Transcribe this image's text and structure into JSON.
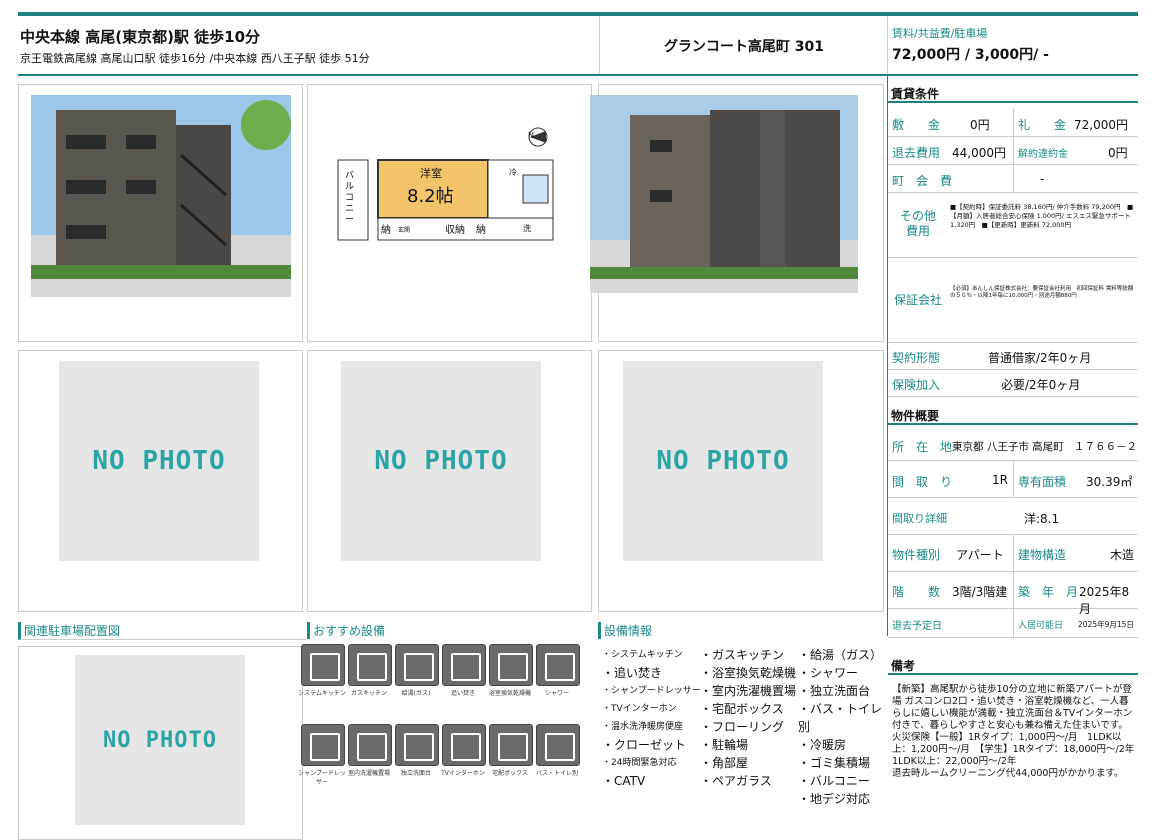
{
  "header": {
    "station_main": "中央本線 高尾(東京都)駅 徒歩10分",
    "station_sub": "京王電鉄高尾線 高尾山口駅 徒歩16分 /中央本線 西八王子駅 徒歩 51分",
    "building_name": "グランコート高尾町 301",
    "rent_label": "賃料/共益費/駐車場",
    "rent_value": "72,000円 / 3,000円/ -"
  },
  "photos": {
    "nophoto_text": "NO PHOTO",
    "floorplan": {
      "room": "洋室",
      "size": "8.2帖",
      "balcony": "バルコニー",
      "storage": "収納",
      "nou1": "納",
      "nou2": "納",
      "entrance": "玄関",
      "wash": "洗",
      "fridge": "冷",
      "compass": "N"
    }
  },
  "sections": {
    "parking_map": "関連駐車場配置図",
    "recommended": "おすすめ設備",
    "equipment_info": "設備情報"
  },
  "recommended_icons": [
    {
      "icon": "system-kitchen-icon",
      "label": "システムキッチン"
    },
    {
      "icon": "gas-stove-icon",
      "label": "ガスキッチン"
    },
    {
      "icon": "water-heater-icon",
      "label": "給湯(ガス)"
    },
    {
      "icon": "reheat-bath-icon",
      "label": "追い焚き"
    },
    {
      "icon": "bath-dryer-icon",
      "label": "浴室換気乾燥機"
    },
    {
      "icon": "shower-icon",
      "label": "シャワー"
    },
    {
      "icon": "shampoo-dresser-icon",
      "label": "シャンプードレッサー"
    },
    {
      "icon": "washer-space-icon",
      "label": "室内洗濯機置場"
    },
    {
      "icon": "vanity-icon",
      "label": "独立洗面台"
    },
    {
      "icon": "tv-intercom-icon",
      "label": "TVインターホン"
    },
    {
      "icon": "delivery-box-icon",
      "label": "宅配ボックス"
    },
    {
      "icon": "separate-toilet-icon",
      "label": "バス・トイレ別"
    }
  ],
  "equipment": {
    "col1": [
      "・システムキッチン",
      "・追い焚き",
      "・シャンプードレッサー",
      "・TVインターホン",
      "・温水洗浄暖房便座",
      "・クローゼット",
      "・24時間緊急対応",
      "・CATV"
    ],
    "col2": [
      "・ガスキッチン",
      "・浴室換気乾燥機",
      "・室内洗濯機置場",
      "・宅配ボックス",
      "・フローリング",
      "・駐輪場",
      "・角部屋",
      "・ペアガラス"
    ],
    "col3": [
      "・給湯（ガス）",
      "・シャワー",
      "・独立洗面台",
      "・バス・トイレ別",
      "・冷暖房",
      "・ゴミ集積場",
      "・バルコニー",
      "・地デジ対応"
    ]
  },
  "conditions": {
    "title": "賃貸条件",
    "shikikin_label": "敷　　金",
    "shikikin": "0円",
    "reikin_label": "礼　　金",
    "reikin": "72,000円",
    "taikyo_label": "退去費用",
    "taikyo": "44,000円",
    "kaiyaku_label": "解約違約金",
    "kaiyaku": "0円",
    "choukai_label": "町　会　費",
    "choukai": "-",
    "other_label_1": "その他",
    "other_label_2": "費用",
    "other_text": "■【契約時】保証委託料 38,160円/ 仲介手数料 79,200円　■【月額】入居者総合安心保険 1,000円/ エスエス緊急サポート 1,320円　■【更新時】更新料 72,000円",
    "guarantor_label": "保証会社",
    "guarantor_text": "【必須】あんしん保証株式会社：要保証会社利用　初回保証料 賃料等総額の５０％・以降1年毎に10,000円・別途月額880円",
    "contract_label": "契約形態",
    "contract": "普通借家/2年0ヶ月",
    "insurance_label": "保険加入",
    "insurance": "必要/2年0ヶ月"
  },
  "overview": {
    "title": "物件概要",
    "address_label": "所　在　地",
    "address": "東京都 八王子市 高尾町　１７６６－２",
    "layout_label": "間　取　り",
    "layout": "1R",
    "area_label": "専有面積",
    "area": "30.39㎡",
    "layout_detail_label": "間取り詳細",
    "layout_detail": "洋:8.1",
    "type_label": "物件種別",
    "type": "アパート",
    "structure_label": "建物構造",
    "structure": "木造",
    "floor_label": "階　　数",
    "floor": "3階/3階建",
    "built_label": "築　年　月",
    "built": "2025年8月",
    "moveout_label": "退去予定日",
    "moveout": "",
    "movein_label": "入居可能日",
    "movein": "2025年9月15日"
  },
  "remarks": {
    "title": "備考",
    "text": "【新築】高尾駅から徒歩10分の立地に新築アパートが登場 ガスコンロ2口・追い焚き・浴室乾燥機など、一人暮らしに嬉しい機能が満載・独立洗面台＆TVインターホン付きで、暮らしやすさと安心も兼ね備えた住まいです。\n火災保険【一般】1Rタイプ：1,000円～/月　1LDK以上：1,200円～/月　【学生】1Rタイプ：18,000円～/2年　1LDK以上：22,000円～/2年\n退去時ルームクリーニング代44,000円がかかります。"
  },
  "colors": {
    "accent": "#1e8080",
    "label": "#1e8a8a",
    "nophoto_text": "#2aa5a5",
    "nophoto_bg": "#e6e6e6"
  }
}
